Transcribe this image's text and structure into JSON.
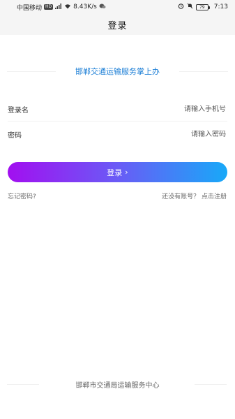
{
  "status_bar": {
    "carrier": "中国移动",
    "hd_badge": "HD",
    "speed": "8.43K/s",
    "battery": "79",
    "time": "7:13"
  },
  "header": {
    "title": "登录"
  },
  "slogan": "邯郸交通运输服务掌上办",
  "form": {
    "username_label": "登录名",
    "username_placeholder": "请输入手机号",
    "password_label": "密码",
    "password_placeholder": "请输入密码",
    "login_button": "登录",
    "login_chevron": "›"
  },
  "links": {
    "forgot_password": "忘记密码?",
    "register": "还没有账号？ 点击注册"
  },
  "footer": "邯郸市交通局运输服务中心"
}
